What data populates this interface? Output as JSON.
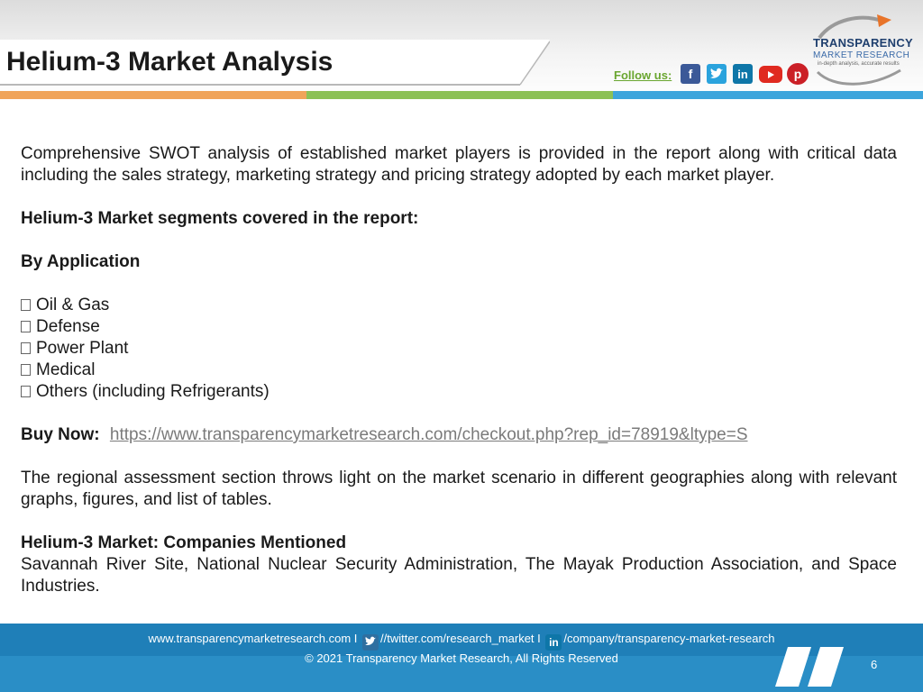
{
  "header": {
    "title": "Helium-3 Market Analysis",
    "follow_label": "Follow us:",
    "social_icons": [
      "facebook-icon",
      "twitter-icon",
      "linkedin-icon",
      "youtube-icon",
      "pinterest-icon"
    ],
    "logo": {
      "line1": "TRANSPARENCY",
      "line2": "MARKET RESEARCH",
      "line3": "in-depth analysis, accurate results"
    }
  },
  "colors": {
    "bar_orange": "#f0a45a",
    "bar_green": "#8cc156",
    "bar_blue": "#3da5dc",
    "footer_blue": "#2a8ec6",
    "follow_green": "#6aa630",
    "logo_navy": "#1f3f6e",
    "logo_orange": "#e8742a"
  },
  "content": {
    "intro": "Comprehensive SWOT analysis of established market players is provided in the report along with critical data including the sales strategy, marketing strategy and pricing strategy adopted by each market player.",
    "segments_heading": "Helium-3 Market segments covered in the report:",
    "by_application": "By  Application",
    "applications": [
      "Oil & Gas",
      "Defense",
      "Power Plant",
      "Medical",
      "Others (including Refrigerants)"
    ],
    "buy_label": "Buy Now:",
    "buy_url": "https://www.transparencymarketresearch.com/checkout.php?rep_id=78919&ltype=S",
    "regional": "The regional assessment section throws light on the market scenario in different geographies along with relevant graphs, figures, and list of tables.",
    "companies_heading": "Helium-3 Market: Companies Mentioned",
    "companies": "Savannah River Site, National Nuclear Security Administration, The Mayak Production Association, and Space Industries."
  },
  "footer": {
    "website": "www.transparencymarketresearch.com",
    "separator": "I",
    "twitter": "//twitter.com/research_market",
    "linkedin": "/company/transparency-market-research",
    "copyright": "© 2021 Transparency Market Research, All Rights Reserved",
    "page_number": "6"
  }
}
